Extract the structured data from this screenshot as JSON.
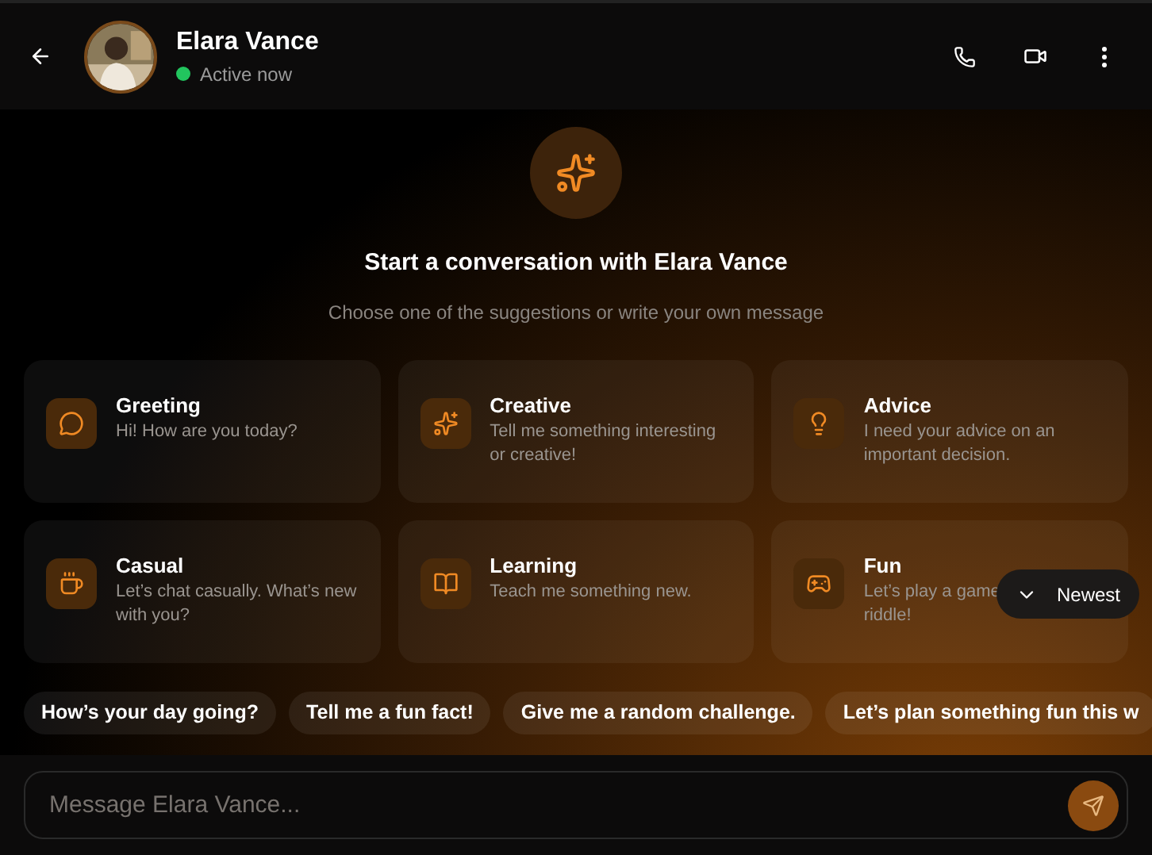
{
  "header": {
    "name": "Elara Vance",
    "status": "Active now",
    "online": true
  },
  "intro": {
    "title": "Start a conversation with Elara Vance",
    "subtitle": "Choose one of the suggestions or write your own message"
  },
  "cards": [
    {
      "kind": "chat",
      "title": "Greeting",
      "lines": [
        "Hi! How are you today?"
      ]
    },
    {
      "kind": "sparkle",
      "title": "Creative",
      "lines": [
        "Tell me something interesting",
        "or creative!"
      ]
    },
    {
      "kind": "bulb",
      "title": "Advice",
      "lines": [
        "I need your advice on an",
        "important decision."
      ]
    },
    {
      "kind": "cup",
      "title": "Casual",
      "lines": [
        "Let’s chat casually. What’s new",
        "with you?"
      ]
    },
    {
      "kind": "book",
      "title": "Learning",
      "lines": [
        "Teach me something new."
      ]
    },
    {
      "kind": "game",
      "title": "Fun",
      "lines": [
        "Let’s play a game",
        "riddle!"
      ]
    }
  ],
  "newest_button": {
    "label": "Newest"
  },
  "chips": [
    "How’s your day going?",
    "Tell me a fun fact!",
    "Give me a random challenge.",
    "Let’s plan something fun this w"
  ],
  "composer": {
    "placeholder": "Message Elara Vance..."
  }
}
